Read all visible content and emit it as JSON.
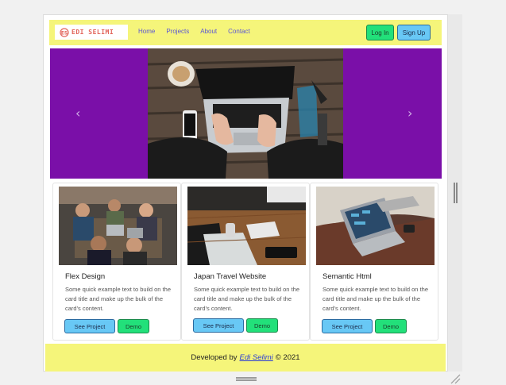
{
  "navbar": {
    "brand": "EDI SELIMI",
    "links": [
      "Home",
      "Projects",
      "About",
      "Contact"
    ],
    "login_label": "Log In",
    "signup_label": "Sign Up"
  },
  "carousel": {
    "prev_icon": "‹",
    "next_icon": "›"
  },
  "cards": [
    {
      "title": "Flex Design",
      "text": "Some quick example text to build on the card title and make up the bulk of the card's content.",
      "project_label": "See Project",
      "demo_label": "Demo"
    },
    {
      "title": "Japan Travel Website",
      "text": "Some quick example text to build on the card title and make up the bulk of the card's content.",
      "project_label": "See Project",
      "demo_label": "Demo"
    },
    {
      "title": "Semantic Html",
      "text": "Some quick example text to build on the card title and make up the bulk of the card's content.",
      "project_label": "See Project",
      "demo_label": "Demo"
    }
  ],
  "footer": {
    "prefix": "Developed by",
    "author": "Edi Selimi",
    "suffix": "© 2021"
  },
  "colors": {
    "navbar_bg": "#f5f57a",
    "carousel_bg": "#7a0fa8",
    "login_btn": "#22e07a",
    "signup_btn": "#68c8f5"
  }
}
